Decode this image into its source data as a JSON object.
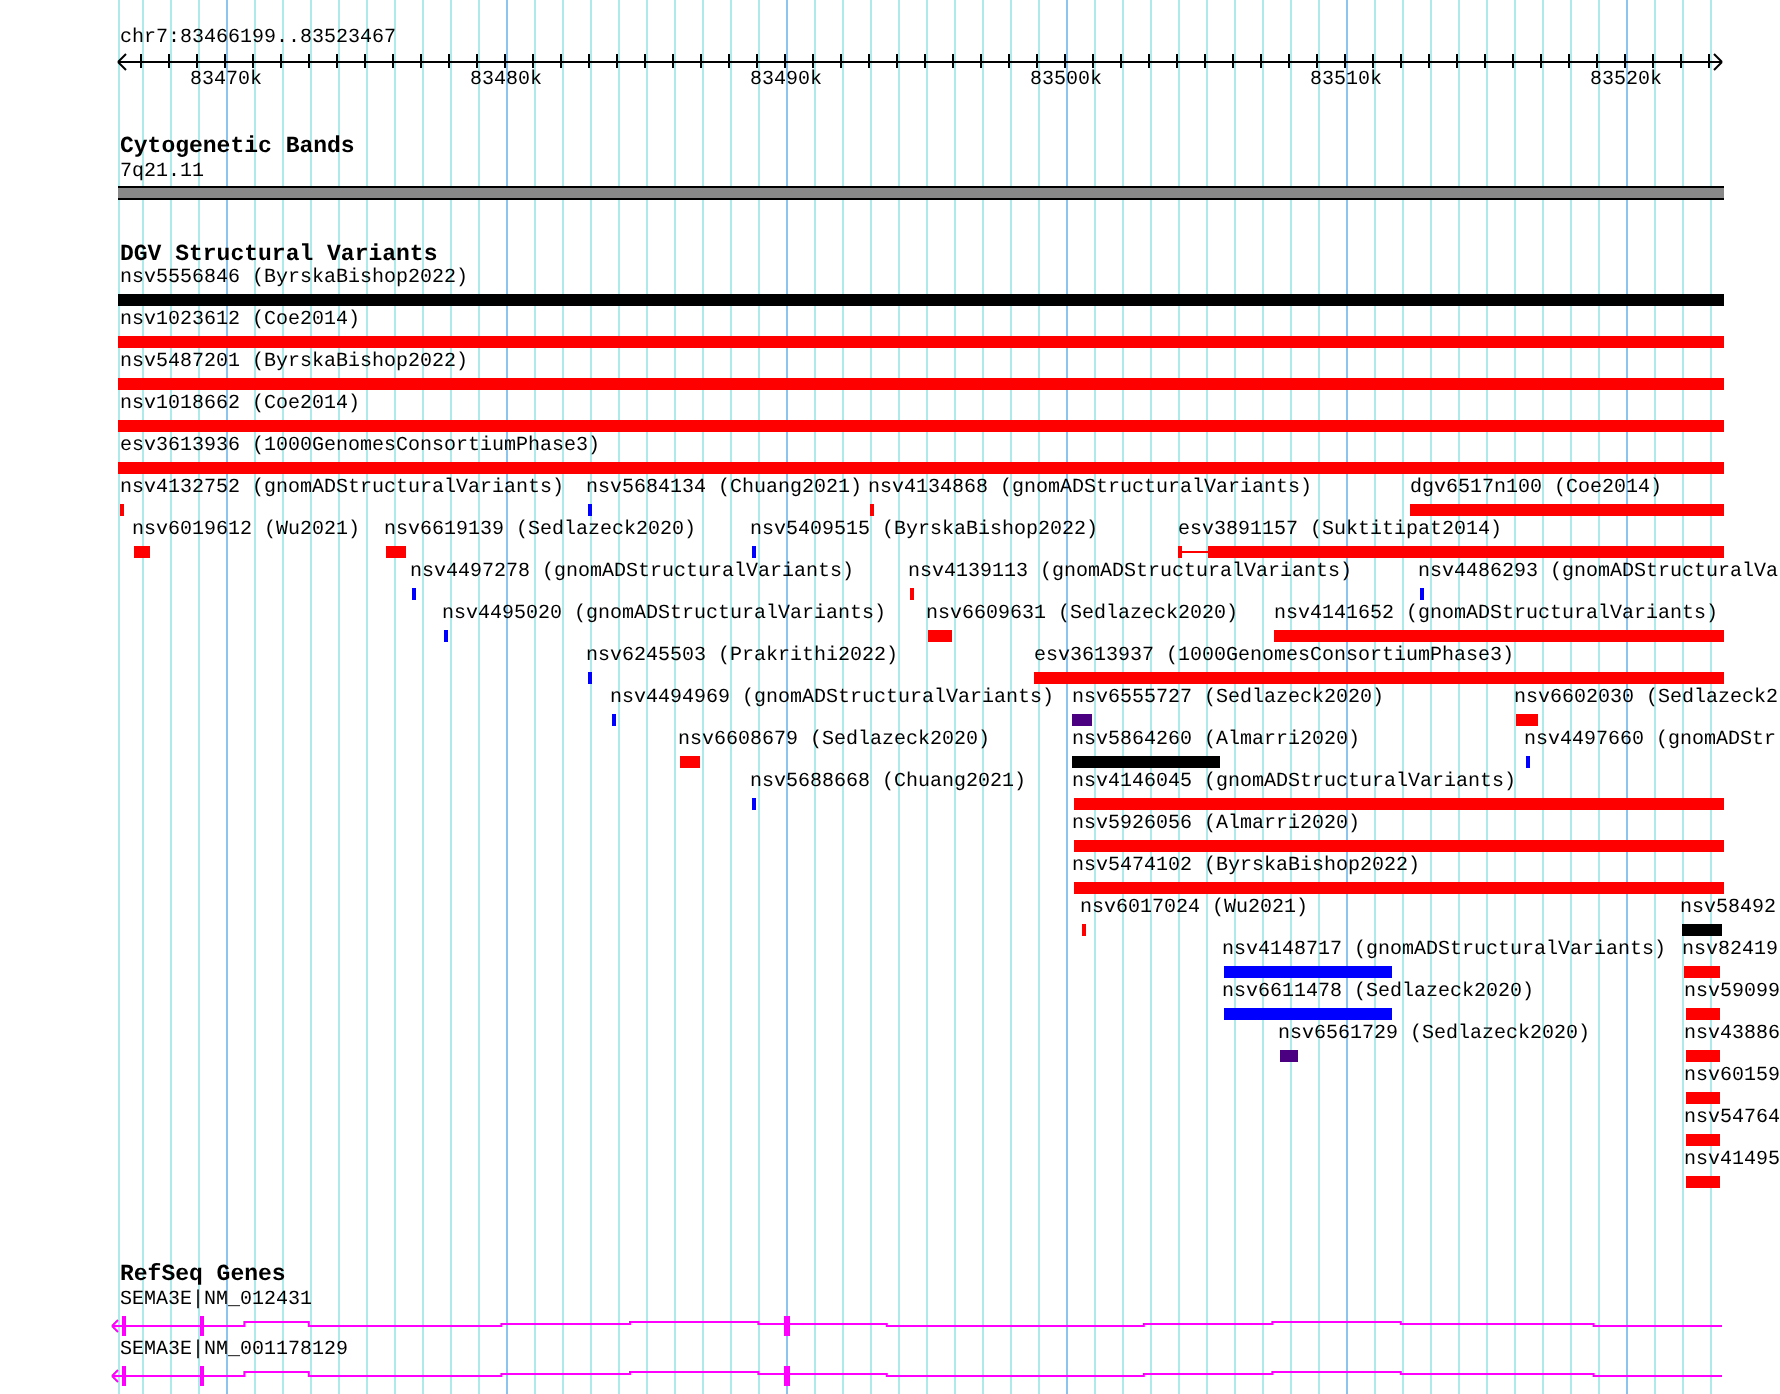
{
  "location": "chr7:83466199..83523467",
  "ruler": {
    "ticks": [
      "83470k",
      "83480k",
      "83490k",
      "83500k",
      "83510k",
      "83520k"
    ]
  },
  "cytogenetic_bands": {
    "title": "Cytogenetic Bands",
    "bands": [
      {
        "label": "7q21.11",
        "color": "#888888"
      }
    ]
  },
  "dgv_structural_variants": {
    "title": "DGV Structural Variants",
    "features": [
      {
        "label": "nsv5556846 (ByrskaBishop2022)",
        "color": "#000000"
      },
      {
        "label": "nsv1023612 (Coe2014)",
        "color": "#ff0000"
      },
      {
        "label": "nsv5487201 (ByrskaBishop2022)",
        "color": "#ff0000"
      },
      {
        "label": "nsv1018662 (Coe2014)",
        "color": "#ff0000"
      },
      {
        "label": "esv3613936 (1000GenomesConsortiumPhase3)",
        "color": "#ff0000"
      },
      {
        "label": "nsv4132752 (gnomADStructuralVariants)",
        "color": "#ff0000"
      },
      {
        "label": "nsv5684134 (Chuang2021)",
        "color": "#0000ff"
      },
      {
        "label": "nsv4134868 (gnomADStructuralVariants)",
        "color": "#ff0000"
      },
      {
        "label": "dgv6517n100 (Coe2014)",
        "color": "#ff0000"
      },
      {
        "label": "nsv6019612 (Wu2021)",
        "color": "#ff0000"
      },
      {
        "label": "nsv6619139 (Sedlazeck2020)",
        "color": "#ff0000"
      },
      {
        "label": "nsv5409515 (ByrskaBishop2022)",
        "color": "#0000ff"
      },
      {
        "label": "esv3891157 (Suktitipat2014)",
        "color": "#ff0000"
      },
      {
        "label": "nsv4497278 (gnomADStructuralVariants)",
        "color": "#0000ff"
      },
      {
        "label": "nsv4139113 (gnomADStructuralVariants)",
        "color": "#ff0000"
      },
      {
        "label": "nsv4486293 (gnomADStructuralVa",
        "color": "#0000ff"
      },
      {
        "label": "nsv4495020 (gnomADStructuralVariants)",
        "color": "#0000ff"
      },
      {
        "label": "nsv6609631 (Sedlazeck2020)",
        "color": "#ff0000"
      },
      {
        "label": "nsv4141652 (gnomADStructuralVariants)",
        "color": "#ff0000"
      },
      {
        "label": "nsv6245503 (Prakrithi2022)",
        "color": "#0000ff"
      },
      {
        "label": "esv3613937 (1000GenomesConsortiumPhase3)",
        "color": "#ff0000"
      },
      {
        "label": "nsv4494969 (gnomADStructuralVariants)",
        "color": "#0000ff"
      },
      {
        "label": "nsv6555727 (Sedlazeck2020)",
        "color": "#4b0082"
      },
      {
        "label": "nsv6602030 (Sedlazeck2",
        "color": "#ff0000"
      },
      {
        "label": "nsv6608679 (Sedlazeck2020)",
        "color": "#ff0000"
      },
      {
        "label": "nsv5864260 (Almarri2020)",
        "color": "#000000"
      },
      {
        "label": "nsv4497660 (gnomADStr",
        "color": "#0000ff"
      },
      {
        "label": "nsv5688668 (Chuang2021)",
        "color": "#0000ff"
      },
      {
        "label": "nsv4146045 (gnomADStructuralVariants)",
        "color": "#ff0000"
      },
      {
        "label": "nsv5926056 (Almarri2020)",
        "color": "#ff0000"
      },
      {
        "label": "nsv5474102 (ByrskaBishop2022)",
        "color": "#ff0000"
      },
      {
        "label": "nsv6017024 (Wu2021)",
        "color": "#ff0000"
      },
      {
        "label": "nsv58492",
        "color": "#000000"
      },
      {
        "label": "nsv4148717 (gnomADStructuralVariants)",
        "color": "#0000ff"
      },
      {
        "label": "nsv82419",
        "color": "#ff0000"
      },
      {
        "label": "nsv6611478 (Sedlazeck2020)",
        "color": "#0000ff"
      },
      {
        "label": "nsv59099",
        "color": "#ff0000"
      },
      {
        "label": "nsv6561729 (Sedlazeck2020)",
        "color": "#4b0082"
      },
      {
        "label": "nsv43886",
        "color": "#ff0000"
      },
      {
        "label": "nsv60159",
        "color": "#ff0000"
      },
      {
        "label": "nsv54764",
        "color": "#ff0000"
      },
      {
        "label": "nsv41495",
        "color": "#ff0000"
      }
    ]
  },
  "refseq_genes": {
    "title": "RefSeq Genes",
    "genes": [
      {
        "label": "SEMA3E|NM_012431"
      },
      {
        "label": "SEMA3E|NM_001178129"
      }
    ]
  }
}
